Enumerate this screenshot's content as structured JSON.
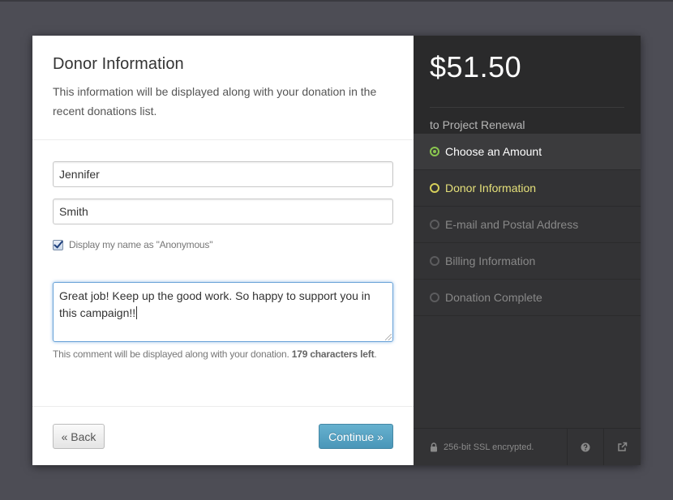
{
  "donor_form": {
    "title": "Donor Information",
    "description": "This information will be displayed along with your donation in the recent donations list.",
    "first_name": "Jennifer",
    "last_name": "Smith",
    "anonymous_checked": true,
    "anonymous_label": "Display my name as \"Anonymous\"",
    "comment": "Great job!  Keep up the good work. So happy to support you in this campaign!!",
    "help_text": "This comment will be displayed along with your donation.",
    "chars_left": "179 characters left",
    "help_text_end": "."
  },
  "buttons": {
    "back": "« Back",
    "continue": "Continue »"
  },
  "summary": {
    "amount": "$51.50",
    "project": "to Project Renewal"
  },
  "steps": [
    {
      "label": "Choose an Amount",
      "state": "done"
    },
    {
      "label": "Donor Information",
      "state": "active"
    },
    {
      "label": "E-mail and Postal Address",
      "state": "pending"
    },
    {
      "label": "Billing Information",
      "state": "pending"
    },
    {
      "label": "Donation Complete",
      "state": "pending"
    }
  ],
  "footer": {
    "ssl": "256-bit SSL encrypted.",
    "icons": [
      "lock-icon",
      "help-icon",
      "external-link-icon"
    ]
  },
  "colors": {
    "done": "#8ac64f",
    "active": "#e5e07a",
    "continue_button": "#4a96b8"
  }
}
